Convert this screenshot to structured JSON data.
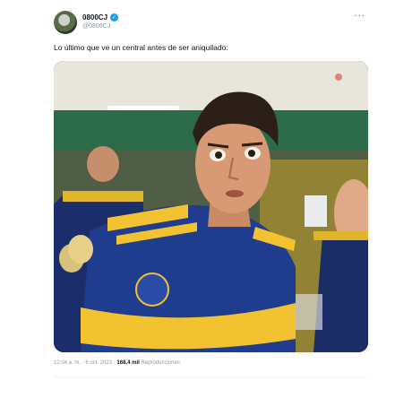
{
  "tweet": {
    "display_name": "0800CJ",
    "handle": "@0800CJ",
    "verified_icon": "verified-badge-icon",
    "more_icon": "more-options-icon",
    "text": "Lo último que ve un central antes de ser aniquilado:",
    "time": "12:04 a. m.",
    "separator": "·",
    "date": "6 oct. 2023",
    "views_count": "168,4 mil",
    "views_label": "Reproducciones"
  },
  "colors": {
    "verified": "#1d9bf0",
    "text_primary": "#0f1419",
    "text_secondary": "#8b98a5",
    "jersey_blue": "#1f3c8f",
    "jersey_gold": "#f2c230"
  }
}
